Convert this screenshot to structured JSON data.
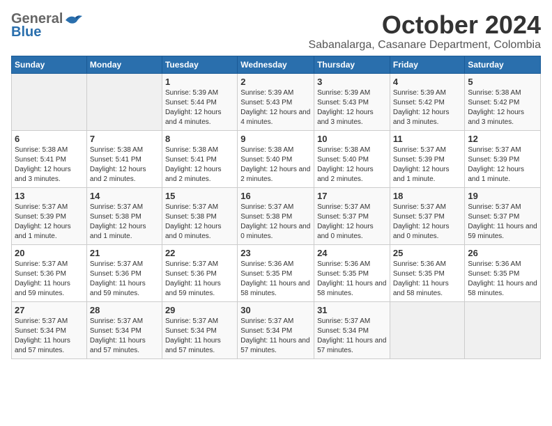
{
  "header": {
    "logo_general": "General",
    "logo_blue": "Blue",
    "month_title": "October 2024",
    "location": "Sabanalarga, Casanare Department, Colombia"
  },
  "weekdays": [
    "Sunday",
    "Monday",
    "Tuesday",
    "Wednesday",
    "Thursday",
    "Friday",
    "Saturday"
  ],
  "weeks": [
    [
      {
        "day": "",
        "info": ""
      },
      {
        "day": "",
        "info": ""
      },
      {
        "day": "1",
        "info": "Sunrise: 5:39 AM\nSunset: 5:44 PM\nDaylight: 12 hours and 4 minutes."
      },
      {
        "day": "2",
        "info": "Sunrise: 5:39 AM\nSunset: 5:43 PM\nDaylight: 12 hours and 4 minutes."
      },
      {
        "day": "3",
        "info": "Sunrise: 5:39 AM\nSunset: 5:43 PM\nDaylight: 12 hours and 3 minutes."
      },
      {
        "day": "4",
        "info": "Sunrise: 5:39 AM\nSunset: 5:42 PM\nDaylight: 12 hours and 3 minutes."
      },
      {
        "day": "5",
        "info": "Sunrise: 5:38 AM\nSunset: 5:42 PM\nDaylight: 12 hours and 3 minutes."
      }
    ],
    [
      {
        "day": "6",
        "info": "Sunrise: 5:38 AM\nSunset: 5:41 PM\nDaylight: 12 hours and 3 minutes."
      },
      {
        "day": "7",
        "info": "Sunrise: 5:38 AM\nSunset: 5:41 PM\nDaylight: 12 hours and 2 minutes."
      },
      {
        "day": "8",
        "info": "Sunrise: 5:38 AM\nSunset: 5:41 PM\nDaylight: 12 hours and 2 minutes."
      },
      {
        "day": "9",
        "info": "Sunrise: 5:38 AM\nSunset: 5:40 PM\nDaylight: 12 hours and 2 minutes."
      },
      {
        "day": "10",
        "info": "Sunrise: 5:38 AM\nSunset: 5:40 PM\nDaylight: 12 hours and 2 minutes."
      },
      {
        "day": "11",
        "info": "Sunrise: 5:37 AM\nSunset: 5:39 PM\nDaylight: 12 hours and 1 minute."
      },
      {
        "day": "12",
        "info": "Sunrise: 5:37 AM\nSunset: 5:39 PM\nDaylight: 12 hours and 1 minute."
      }
    ],
    [
      {
        "day": "13",
        "info": "Sunrise: 5:37 AM\nSunset: 5:39 PM\nDaylight: 12 hours and 1 minute."
      },
      {
        "day": "14",
        "info": "Sunrise: 5:37 AM\nSunset: 5:38 PM\nDaylight: 12 hours and 1 minute."
      },
      {
        "day": "15",
        "info": "Sunrise: 5:37 AM\nSunset: 5:38 PM\nDaylight: 12 hours and 0 minutes."
      },
      {
        "day": "16",
        "info": "Sunrise: 5:37 AM\nSunset: 5:38 PM\nDaylight: 12 hours and 0 minutes."
      },
      {
        "day": "17",
        "info": "Sunrise: 5:37 AM\nSunset: 5:37 PM\nDaylight: 12 hours and 0 minutes."
      },
      {
        "day": "18",
        "info": "Sunrise: 5:37 AM\nSunset: 5:37 PM\nDaylight: 12 hours and 0 minutes."
      },
      {
        "day": "19",
        "info": "Sunrise: 5:37 AM\nSunset: 5:37 PM\nDaylight: 11 hours and 59 minutes."
      }
    ],
    [
      {
        "day": "20",
        "info": "Sunrise: 5:37 AM\nSunset: 5:36 PM\nDaylight: 11 hours and 59 minutes."
      },
      {
        "day": "21",
        "info": "Sunrise: 5:37 AM\nSunset: 5:36 PM\nDaylight: 11 hours and 59 minutes."
      },
      {
        "day": "22",
        "info": "Sunrise: 5:37 AM\nSunset: 5:36 PM\nDaylight: 11 hours and 59 minutes."
      },
      {
        "day": "23",
        "info": "Sunrise: 5:36 AM\nSunset: 5:35 PM\nDaylight: 11 hours and 58 minutes."
      },
      {
        "day": "24",
        "info": "Sunrise: 5:36 AM\nSunset: 5:35 PM\nDaylight: 11 hours and 58 minutes."
      },
      {
        "day": "25",
        "info": "Sunrise: 5:36 AM\nSunset: 5:35 PM\nDaylight: 11 hours and 58 minutes."
      },
      {
        "day": "26",
        "info": "Sunrise: 5:36 AM\nSunset: 5:35 PM\nDaylight: 11 hours and 58 minutes."
      }
    ],
    [
      {
        "day": "27",
        "info": "Sunrise: 5:37 AM\nSunset: 5:34 PM\nDaylight: 11 hours and 57 minutes."
      },
      {
        "day": "28",
        "info": "Sunrise: 5:37 AM\nSunset: 5:34 PM\nDaylight: 11 hours and 57 minutes."
      },
      {
        "day": "29",
        "info": "Sunrise: 5:37 AM\nSunset: 5:34 PM\nDaylight: 11 hours and 57 minutes."
      },
      {
        "day": "30",
        "info": "Sunrise: 5:37 AM\nSunset: 5:34 PM\nDaylight: 11 hours and 57 minutes."
      },
      {
        "day": "31",
        "info": "Sunrise: 5:37 AM\nSunset: 5:34 PM\nDaylight: 11 hours and 57 minutes."
      },
      {
        "day": "",
        "info": ""
      },
      {
        "day": "",
        "info": ""
      }
    ]
  ]
}
